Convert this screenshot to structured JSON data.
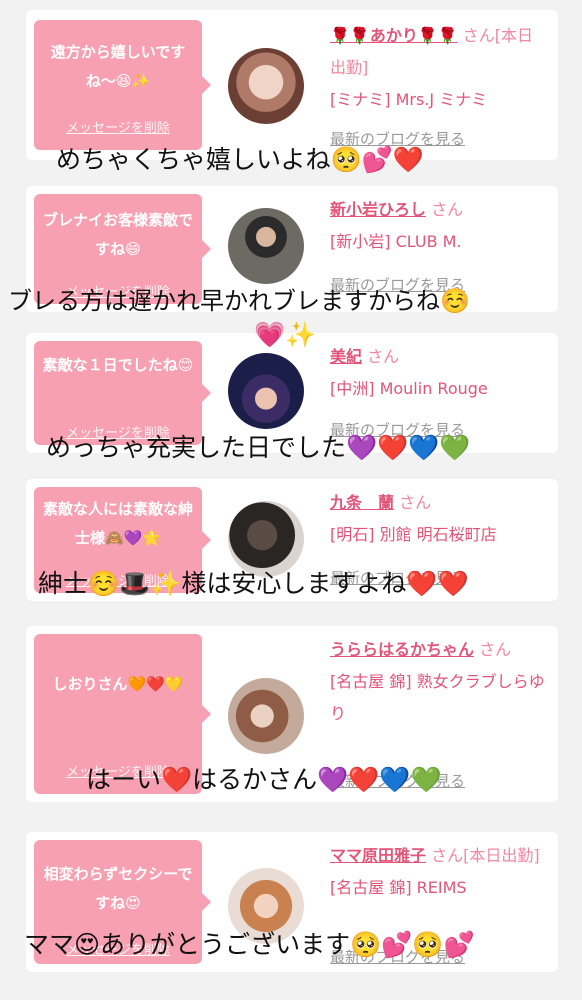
{
  "colors": {
    "bubble": "#f7a0b2",
    "accent": "#e35479",
    "blog": "#999999",
    "page_bg": "#f2f2f2"
  },
  "delete_label": "メッセージを削除",
  "blog_label": "最新のブログを見る",
  "cards": [
    {
      "message": "遠方から嬉しいですね〜😆✨",
      "name": "🌹🌹あかり🌹🌹",
      "san": " さん[本日出勤]",
      "shop": "[ミナミ] Mrs.J ミナミ",
      "avatar": "woman-light-hair"
    },
    {
      "message": "ブレナイお客様素敵ですね😄",
      "name": "新小岩ひろし",
      "san": " さん",
      "shop": "[新小岩] CLUB M.",
      "avatar": "man-suit"
    },
    {
      "message": "素敵な１日でしたね😊",
      "name": "美紀",
      "san": " さん",
      "shop": "[中洲] Moulin Rouge",
      "avatar": "woman-night"
    },
    {
      "message": "素敵な人には素敵な紳士様🙈💜🌟",
      "name": "九条　蘭",
      "san": " さん",
      "shop": "[明石] 別館 明石桜町店",
      "avatar": "woman-dark"
    },
    {
      "message": "しおりさん🧡❤️💛",
      "name": "うららはるかちゃん",
      "san": " さん",
      "shop": "[名古屋 錦] 熟女クラブしらゆり",
      "avatar": "woman-brown-hair"
    },
    {
      "message": "相変わらずセクシーですね😍",
      "name": "ママ原田雅子",
      "san": " さん[本日出勤]",
      "shop": "[名古屋 錦] REIMS",
      "avatar": "woman-blonde"
    }
  ],
  "overlays": [
    "めちゃくちゃ嬉しいよね🥺💕❤️",
    "ブレる方は遅かれ早かれブレますからね☺️",
    "💗✨",
    "めっちゃ充実した日でした💜❤️💙💚",
    "紳士☺️🎩✨様は安心しますよね❤️❤️",
    "はーい❤️はるかさん💜❤️💙💚",
    "ママ😍ありがとうございます🥺💕🥺💕"
  ]
}
